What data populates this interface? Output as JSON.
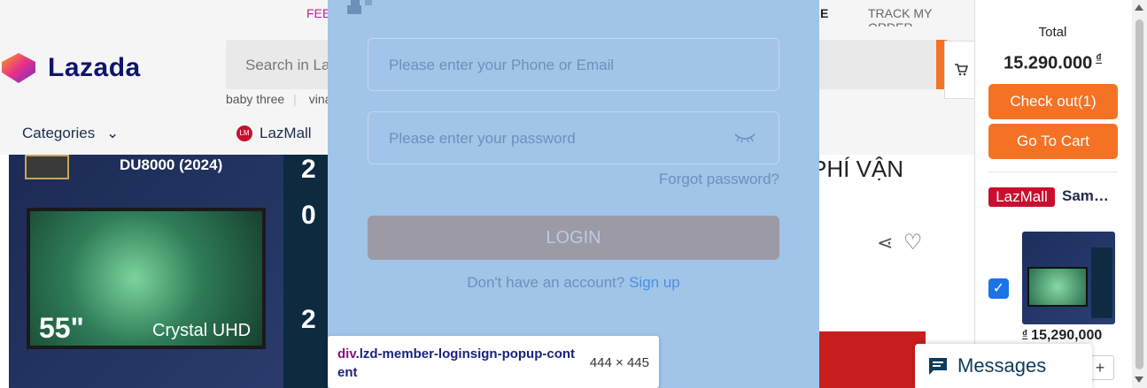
{
  "topbar": {
    "feedback": "FEE",
    "partial": "E",
    "track_order": "TRACK MY ORDER"
  },
  "header": {
    "logo_text": "Lazada",
    "search_placeholder": "Search in La",
    "hints": [
      "baby three",
      "vina"
    ]
  },
  "nav": {
    "categories": "Categories",
    "lazmall": "LazMall",
    "lazmall_icon": "LM"
  },
  "product": {
    "model": "DU8000 (2024)",
    "size": "55\"",
    "brand": "Crystal UHD",
    "side_digits": [
      "2",
      "0",
      "2"
    ]
  },
  "right_title": "PHÍ VẬN",
  "login_popup": {
    "phone_placeholder": "Please enter your Phone or Email",
    "password_placeholder": "Please enter your password",
    "forgot": "Forgot password?",
    "login_button": "LOGIN",
    "no_account": "Don't have an account?",
    "sign_up": "Sign up"
  },
  "inspector_tooltip": {
    "tag": "div",
    "selector": ".lzd-member-loginsign-popup-content",
    "dimensions": "444 × 445"
  },
  "cart_panel": {
    "total_label": "Total",
    "total_value": "15.290.000",
    "currency": "₫",
    "checkout": "Check out(1)",
    "go_to_cart": "Go To Cart",
    "store_badge": "LazMall",
    "store_name": "Samsung",
    "item_price": "15,290,000",
    "qty_plus": "+"
  },
  "messages": {
    "label": "Messages"
  },
  "colors": {
    "accent": "#f57224",
    "overlay": "#a1c4e9",
    "brand_navy": "#0f146d",
    "lazmall_red": "#c8102e"
  }
}
